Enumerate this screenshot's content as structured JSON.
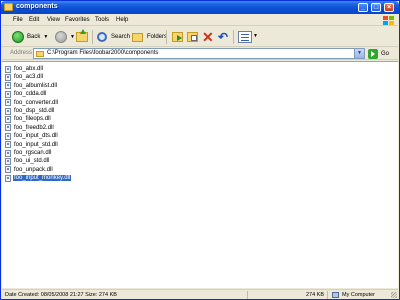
{
  "window": {
    "title": "components"
  },
  "menu": [
    "File",
    "Edit",
    "View",
    "Favorites",
    "Tools",
    "Help"
  ],
  "toolbar": {
    "back_label": "Back",
    "search_label": "Search",
    "folders_label": "Folders"
  },
  "address": {
    "label": "Address",
    "value": "C:\\Program Files\\foobar2000\\components",
    "go_label": "Go"
  },
  "files": [
    {
      "name": "foo_abx.dll",
      "selected": false
    },
    {
      "name": "foo_ac3.dll",
      "selected": false
    },
    {
      "name": "foo_albumlist.dll",
      "selected": false
    },
    {
      "name": "foo_cdda.dll",
      "selected": false
    },
    {
      "name": "foo_converter.dll",
      "selected": false
    },
    {
      "name": "foo_dsp_std.dll",
      "selected": false
    },
    {
      "name": "foo_fileops.dll",
      "selected": false
    },
    {
      "name": "foo_freedb2.dll",
      "selected": false
    },
    {
      "name": "foo_input_dts.dll",
      "selected": false
    },
    {
      "name": "foo_input_std.dll",
      "selected": false
    },
    {
      "name": "foo_rgscan.dll",
      "selected": false
    },
    {
      "name": "foo_ui_std.dll",
      "selected": false
    },
    {
      "name": "foo_unpack.dll",
      "selected": false
    },
    {
      "name": "foo_input_monkey.dll",
      "selected": true
    }
  ],
  "status": {
    "details": "Date Created: 08/05/2008 21:27 Size: 274 KB",
    "size": "274 KB",
    "zone": "My Computer"
  }
}
